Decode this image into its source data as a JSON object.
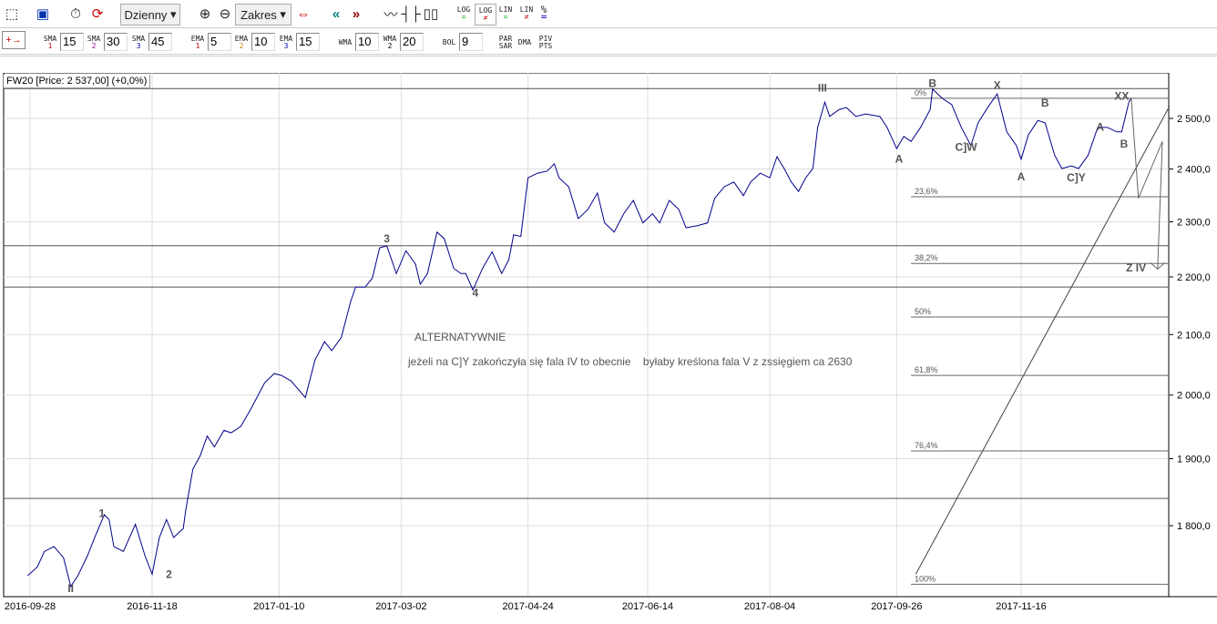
{
  "toolbar": {
    "period": "Dzienny",
    "range": "Zakres",
    "log_eq": "LOG",
    "log_ne": "LOG",
    "lin_eq": "LIN",
    "lin_ne": "LIN",
    "pct": "%"
  },
  "indicators": [
    {
      "label": "SMA",
      "sub": "1",
      "value": "15"
    },
    {
      "label": "SMA",
      "sub": "2",
      "value": "30"
    },
    {
      "label": "SMA",
      "sub": "3",
      "value": "45"
    },
    {
      "label": "EMA",
      "sub": "1",
      "value": "5"
    },
    {
      "label": "EMA",
      "sub": "2",
      "value": "10"
    },
    {
      "label": "EMA",
      "sub": "3",
      "value": "15"
    },
    {
      "label": "WMA",
      "sub": "",
      "value": "10"
    },
    {
      "label": "WMA",
      "sub": "2",
      "value": "20"
    },
    {
      "label": "BOL",
      "sub": "",
      "value": "9"
    }
  ],
  "extra_buttons": {
    "parsar1": "PAR",
    "parsar2": "SAR",
    "dma": "DMA",
    "piv1": "PIV",
    "piv2": "PTS"
  },
  "chart_data": {
    "type": "line",
    "title": "FW20 [Price: 2 537,00] (+0,0%)",
    "line_color": "#00008b",
    "x_ticks": [
      "2016-09-28",
      "2016-11-18",
      "2017-01-10",
      "2017-03-02",
      "2017-04-24",
      "2017-06-14",
      "2017-08-04",
      "2017-09-26",
      "2017-11-16"
    ],
    "y_ticks": [
      "2 500,0",
      "2 400,0",
      "2 300,0",
      "2 200,0",
      "2 100,0",
      "2 000,0",
      "1 900,0",
      "1 800,0"
    ],
    "y_tick_values": [
      2500,
      2400,
      2300,
      2200,
      2100,
      2000,
      1900,
      1800
    ],
    "ylim": [
      1700,
      2562
    ],
    "x_unit": "days since 2016-09-28",
    "series": [
      [
        -1,
        1729
      ],
      [
        3,
        1741
      ],
      [
        6,
        1763
      ],
      [
        10,
        1770
      ],
      [
        14,
        1754
      ],
      [
        17,
        1714
      ],
      [
        20,
        1729
      ],
      [
        24,
        1757
      ],
      [
        27,
        1783
      ],
      [
        31,
        1816
      ],
      [
        33,
        1809
      ],
      [
        35,
        1770
      ],
      [
        39,
        1763
      ],
      [
        44,
        1802
      ],
      [
        48,
        1757
      ],
      [
        51,
        1731
      ],
      [
        54,
        1783
      ],
      [
        57,
        1809
      ],
      [
        60,
        1783
      ],
      [
        64,
        1796
      ],
      [
        65,
        1822
      ],
      [
        68,
        1884
      ],
      [
        71,
        1904
      ],
      [
        74,
        1935
      ],
      [
        77,
        1918
      ],
      [
        81,
        1944
      ],
      [
        84,
        1940
      ],
      [
        88,
        1950
      ],
      [
        92,
        1976
      ],
      [
        98,
        2020
      ],
      [
        102,
        2035
      ],
      [
        105,
        2032
      ],
      [
        109,
        2023
      ],
      [
        115,
        1996
      ],
      [
        119,
        2057
      ],
      [
        123,
        2088
      ],
      [
        126,
        2073
      ],
      [
        130,
        2095
      ],
      [
        134,
        2158
      ],
      [
        136,
        2182
      ],
      [
        140,
        2182
      ],
      [
        143,
        2198
      ],
      [
        146,
        2252
      ],
      [
        149,
        2256
      ],
      [
        153,
        2206
      ],
      [
        157,
        2247
      ],
      [
        161,
        2223
      ],
      [
        163,
        2187
      ],
      [
        166,
        2206
      ],
      [
        170,
        2281
      ],
      [
        173,
        2269
      ],
      [
        177,
        2215
      ],
      [
        180,
        2206
      ],
      [
        182,
        2206
      ],
      [
        185,
        2177
      ],
      [
        189,
        2215
      ],
      [
        193,
        2245
      ],
      [
        197,
        2206
      ],
      [
        200,
        2231
      ],
      [
        202,
        2276
      ],
      [
        205,
        2273
      ],
      [
        208,
        2383
      ],
      [
        212,
        2392
      ],
      [
        216,
        2396
      ],
      [
        219,
        2410
      ],
      [
        221,
        2383
      ],
      [
        225,
        2366
      ],
      [
        229,
        2306
      ],
      [
        233,
        2323
      ],
      [
        237,
        2354
      ],
      [
        240,
        2298
      ],
      [
        244,
        2281
      ],
      [
        248,
        2315
      ],
      [
        252,
        2340
      ],
      [
        256,
        2298
      ],
      [
        260,
        2315
      ],
      [
        263,
        2298
      ],
      [
        267,
        2340
      ],
      [
        271,
        2323
      ],
      [
        274,
        2289
      ],
      [
        279,
        2293
      ],
      [
        283,
        2298
      ],
      [
        286,
        2344
      ],
      [
        290,
        2366
      ],
      [
        294,
        2375
      ],
      [
        298,
        2349
      ],
      [
        301,
        2375
      ],
      [
        305,
        2392
      ],
      [
        309,
        2383
      ],
      [
        312,
        2424
      ],
      [
        315,
        2401
      ],
      [
        318,
        2375
      ],
      [
        321,
        2357
      ],
      [
        324,
        2383
      ],
      [
        327,
        2401
      ],
      [
        329,
        2482
      ],
      [
        332,
        2533
      ],
      [
        334,
        2504
      ],
      [
        338,
        2518
      ],
      [
        341,
        2522
      ],
      [
        345,
        2504
      ],
      [
        349,
        2509
      ],
      [
        355,
        2504
      ],
      [
        358,
        2482
      ],
      [
        362,
        2440
      ],
      [
        365,
        2464
      ],
      [
        368,
        2454
      ],
      [
        372,
        2482
      ],
      [
        376,
        2518
      ],
      [
        377,
        2560
      ],
      [
        381,
        2541
      ],
      [
        385,
        2528
      ],
      [
        389,
        2482
      ],
      [
        393,
        2446
      ],
      [
        396,
        2491
      ],
      [
        400,
        2522
      ],
      [
        404,
        2550
      ],
      [
        408,
        2473
      ],
      [
        412,
        2446
      ],
      [
        414,
        2419
      ],
      [
        417,
        2467
      ],
      [
        421,
        2496
      ],
      [
        424,
        2491
      ],
      [
        428,
        2427
      ],
      [
        431,
        2401
      ],
      [
        435,
        2406
      ],
      [
        438,
        2401
      ],
      [
        442,
        2427
      ],
      [
        446,
        2482
      ],
      [
        450,
        2482
      ],
      [
        454,
        2473
      ],
      [
        456,
        2473
      ],
      [
        459,
        2533
      ],
      [
        460,
        2541
      ]
    ],
    "horizontal_lines": [
      2561,
      2256,
      2182,
      1840
    ],
    "fibonacci": [
      {
        "label": "0%",
        "price": 2541
      },
      {
        "label": "23,6%",
        "price": 2347
      },
      {
        "label": "38,2%",
        "price": 2224
      },
      {
        "label": "50%",
        "price": 2130
      },
      {
        "label": "61,8%",
        "price": 2032
      },
      {
        "label": "76,4%",
        "price": 1912
      },
      {
        "label": "100%",
        "price": 1717
      }
    ],
    "trendline": [
      [
        370,
        1731
      ],
      [
        476,
        2525
      ]
    ],
    "projection": [
      [
        460,
        2541
      ],
      [
        463,
        2344
      ],
      [
        473,
        2454
      ],
      [
        471,
        2214
      ]
    ],
    "wave_labels": [
      {
        "t": "1",
        "d": 30,
        "p": 1818
      },
      {
        "t": "2",
        "d": 58,
        "p": 1731
      },
      {
        "t": "II",
        "d": 17,
        "p": 1711
      },
      {
        "t": "3",
        "d": 149,
        "p": 2269
      },
      {
        "t": "4",
        "d": 186,
        "p": 2172
      },
      {
        "t": "III",
        "d": 331,
        "p": 2562
      },
      {
        "t": "A",
        "d": 363,
        "p": 2420
      },
      {
        "t": "B",
        "d": 377,
        "p": 2572
      },
      {
        "t": "C]W",
        "d": 391,
        "p": 2443
      },
      {
        "t": "X",
        "d": 404,
        "p": 2568
      },
      {
        "t": "A",
        "d": 414,
        "p": 2385
      },
      {
        "t": "B",
        "d": 424,
        "p": 2531
      },
      {
        "t": "C]Y",
        "d": 437,
        "p": 2383
      },
      {
        "t": "A",
        "d": 447,
        "p": 2483
      },
      {
        "t": "B",
        "d": 457,
        "p": 2449
      },
      {
        "t": "XX",
        "d": 456,
        "p": 2545
      },
      {
        "t": "Z IV",
        "d": 462,
        "p": 2216
      }
    ],
    "annotations": [
      "ALTERNATYWNIE",
      "jeżeli na C]Y zakończyła się fala IV to obecnie    byłaby kreślona fala V z zssięgiem ca 2630"
    ]
  }
}
